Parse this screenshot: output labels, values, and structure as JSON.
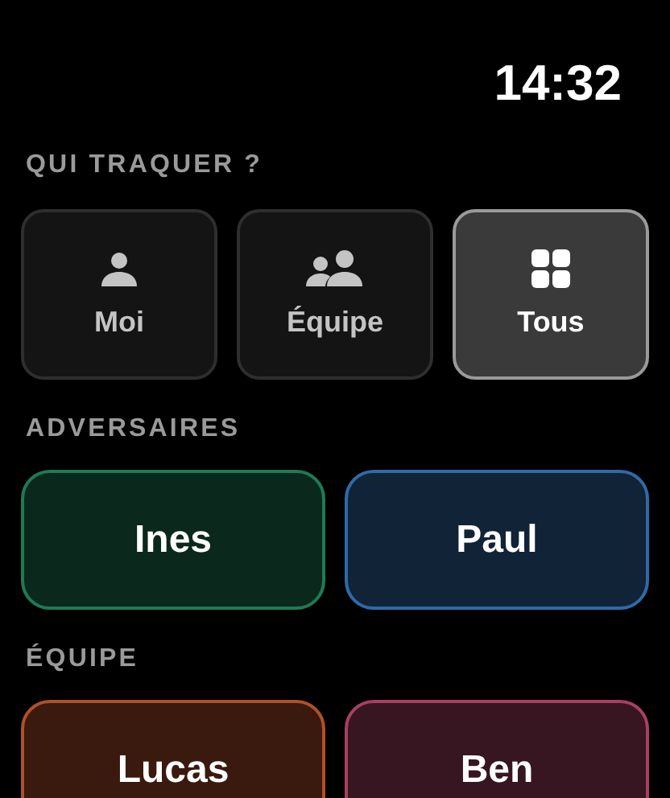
{
  "status_bar": {
    "time": "14:32"
  },
  "modes": {
    "title": "QUI TRAQUER ?",
    "items": [
      {
        "label": "Moi",
        "kind": "person",
        "selected": false
      },
      {
        "label": "Équipe",
        "kind": "group",
        "selected": false
      },
      {
        "label": "Tous",
        "kind": "grid",
        "selected": true
      }
    ]
  },
  "sections": [
    {
      "title": "ADVERSAIRES",
      "players": [
        {
          "name": "Ines",
          "color": "#1f7a55"
        },
        {
          "name": "Paul",
          "color": "#2f6aa8"
        }
      ]
    },
    {
      "title": "ÉQUIPE",
      "players": [
        {
          "name": "Lucas",
          "color": "#b0502a"
        },
        {
          "name": "Ben",
          "color": "#a83f63"
        }
      ]
    }
  ]
}
